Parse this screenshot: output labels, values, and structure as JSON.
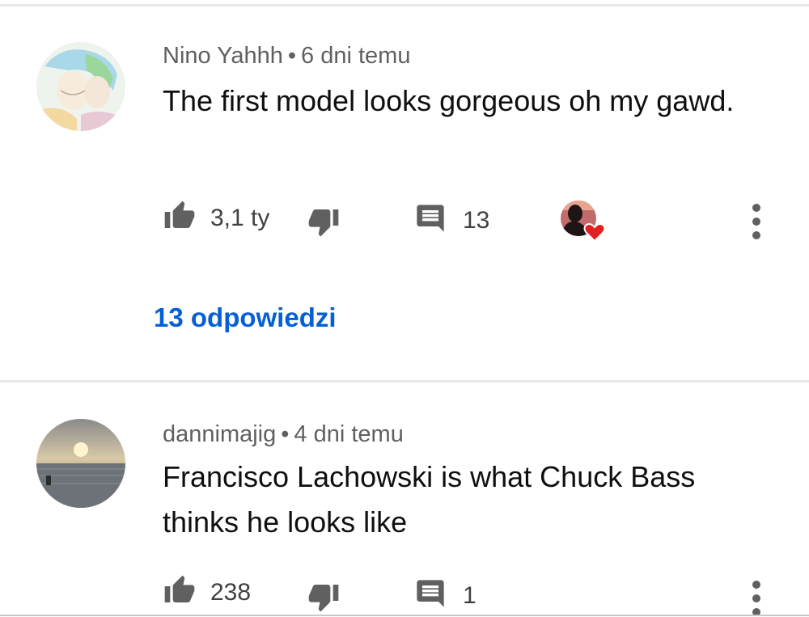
{
  "comments": [
    {
      "author": "Nino Yahhh",
      "time": "6 dni temu",
      "text": "The first model looks gorgeous oh my gawd.",
      "likes": "3,1 ty",
      "reply_count": "13",
      "replies_label": "13 odpowiedzi",
      "creator_heart": true
    },
    {
      "author": "dannimajig",
      "time": "4 dni temu",
      "text": "Francisco Lachowski is what Chuck Bass thinks he looks like",
      "likes": "238",
      "reply_count": "1"
    }
  ],
  "icons": {
    "like": "thumbs-up-icon",
    "dislike": "thumbs-down-icon",
    "reply": "comment-icon",
    "more": "more-vert-icon",
    "heart": "heart-icon"
  },
  "colors": {
    "link": "#065fd4",
    "meta": "#606060",
    "heart": "#e32020",
    "divider": "#e6e6e6"
  }
}
